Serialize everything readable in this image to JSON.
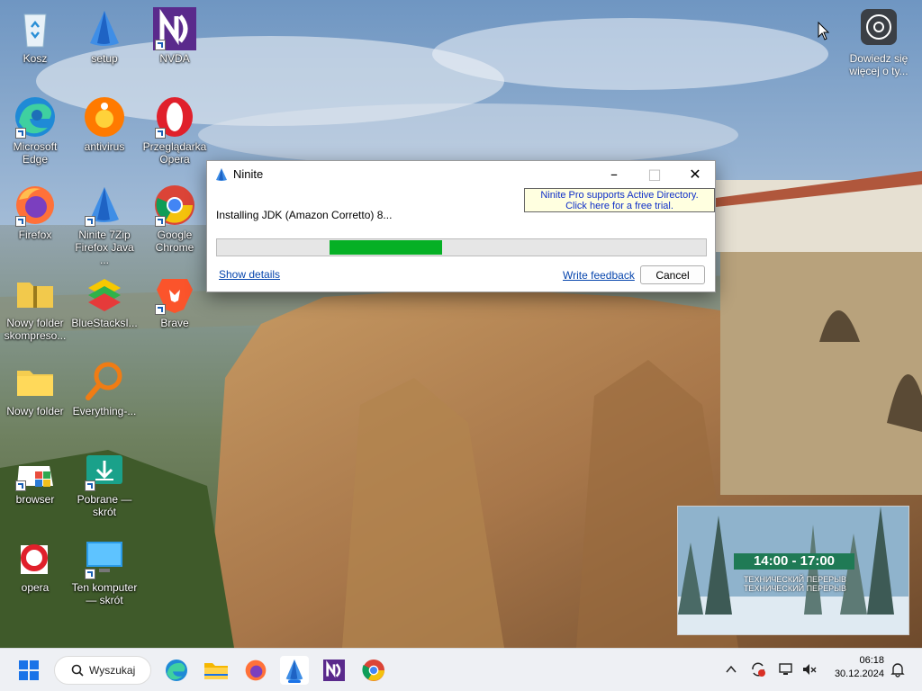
{
  "desktop": {
    "icons": [
      {
        "label": "Kosz"
      },
      {
        "label": "setup"
      },
      {
        "label": "NVDA"
      },
      {
        "label": "Microsoft Edge"
      },
      {
        "label": "antivirus"
      },
      {
        "label": "Przeglądarka Opera"
      },
      {
        "label": "Firefox"
      },
      {
        "label": "Ninite 7Zip Firefox Java ..."
      },
      {
        "label": "Google Chrome"
      },
      {
        "label": "Nowy folder skompreso..."
      },
      {
        "label": "BlueStacksI..."
      },
      {
        "label": "Brave"
      },
      {
        "label": "Nowy folder"
      },
      {
        "label": "Everything-..."
      },
      {
        "label": "browser"
      },
      {
        "label": "Pobrane — skrót"
      },
      {
        "label": "opera"
      },
      {
        "label": "Ten komputer — skrót"
      }
    ],
    "learn_more": "Dowiedz się więcej o ty..."
  },
  "ninite_window": {
    "title": "Ninite",
    "promo_line1": "Ninite Pro supports Active Directory.",
    "promo_line2": "Click here for a free trial.",
    "status": "Installing JDK (Amazon Corretto) 8...",
    "progress_fraction": 0.23,
    "show_details": "Show details",
    "write_feedback": "Write feedback",
    "cancel": "Cancel"
  },
  "widget": {
    "time": "14:00 - 17:00",
    "caption_line1": "ТЕХНИЧЕСКИЙ ПЕРЕРЫВ",
    "caption_line2": "ТЕХНИЧЕСКИЙ ПЕРЕРЫВ"
  },
  "taskbar": {
    "search_placeholder": "Wyszukaj",
    "time": "06:18",
    "date": "30.12.2024"
  }
}
